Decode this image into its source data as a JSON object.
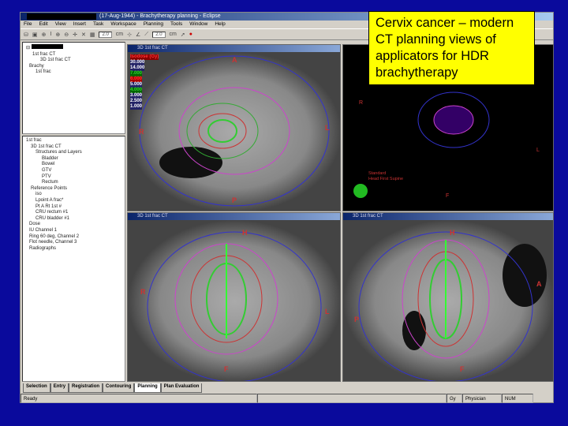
{
  "window": {
    "title": "(17-Aug-1944) - Brachytherapy planning - Eclipse"
  },
  "menu": [
    "File",
    "Edit",
    "View",
    "Insert",
    "Task",
    "Workspace",
    "Planning",
    "Tools",
    "Window",
    "Help"
  ],
  "toolbar": {
    "field1": "2.0",
    "unit1": "cm",
    "field2": "2.0",
    "unit2": "cm"
  },
  "tree1": [
    "1st frac CT",
    "3D 1st frac CT",
    "Brachy",
    "1st frac"
  ],
  "tree2": [
    "1st frac",
    "3D 1st frac CT",
    "Structures and Layers",
    "Bladder",
    "Bowel",
    "GTV",
    "PTV",
    "Rectum",
    "Reference Points",
    "iso",
    "Lpoint A frac*",
    "Pt A Rt 1st #",
    "CRU rectum #1",
    "CRU bladder #1",
    "Dose",
    "IU Channel 1",
    "Ring 60 deg, Channel 2",
    "Flot needle, Channel 3",
    "Radiographs"
  ],
  "viewports": {
    "tl": {
      "title": "3D 1st frac CT",
      "iso": [
        "Isodose (Gy)",
        "30.000",
        "14.000",
        "7.000",
        "6.000",
        "5.000",
        "4.000",
        "3.000",
        "2.500",
        "1.000"
      ],
      "labels": [
        "A",
        "R",
        "L",
        "P"
      ]
    },
    "tr": {
      "labels": [
        "R",
        "L",
        "F"
      ],
      "orientation": [
        "Standard",
        "Head First Supine"
      ]
    },
    "bl": {
      "title": "3D 1st frac CT",
      "labels": [
        "H",
        "R",
        "L",
        "F"
      ]
    },
    "br": {
      "title": "3D 1st frac CT",
      "labels": [
        "H",
        "A",
        "P",
        "F"
      ]
    }
  },
  "tabs": [
    "Selection",
    "Entry",
    "Registration",
    "Contouring",
    "Planning",
    "Plan Evaluation"
  ],
  "status": {
    "left": "Ready",
    "c1": "Gy",
    "c2": "Physician",
    "c3": "NUM"
  },
  "callout": "Cervix cancer – modern CT planning views of applicators for HDR brachytherapy"
}
